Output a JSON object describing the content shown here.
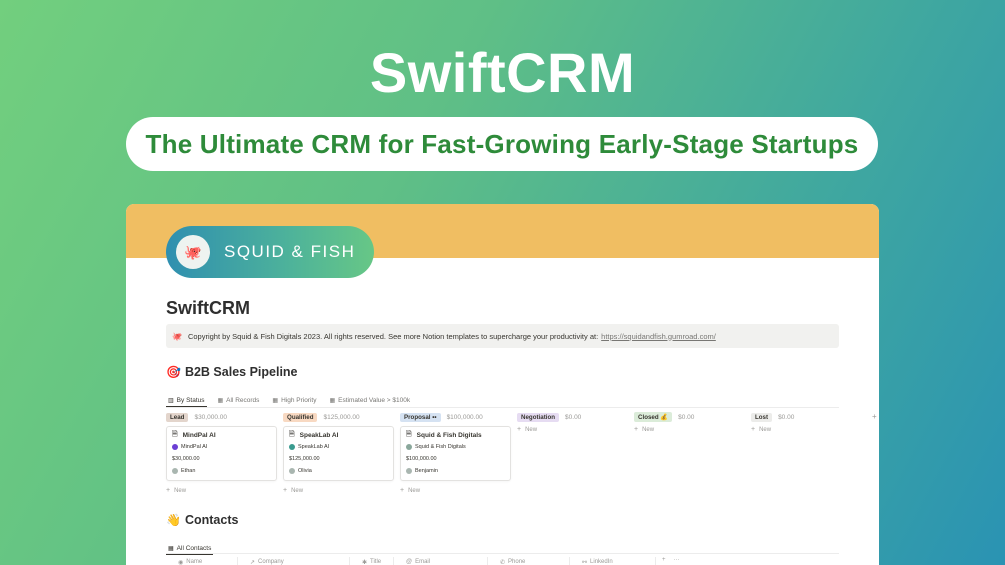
{
  "hero": {
    "title": "SwiftCRM",
    "tagline": "The Ultimate CRM for Fast-Growing Early-Stage Startups"
  },
  "brand": {
    "name": "SQUID & FISH",
    "logo_icon": "squid-fish-logo"
  },
  "page": {
    "title": "SwiftCRM",
    "callout": {
      "icon": "squid-icon",
      "text": "Copyright by Squid & Fish Digitals 2023. All rights reserved. See more Notion templates to supercharge your productivity at:",
      "link": "https://squidandfish.gumroad.com/"
    }
  },
  "pipeline": {
    "heading": "B2B Sales Pipeline",
    "heading_icon": "target-icon",
    "views": [
      {
        "label": "By Status",
        "icon": "board-icon"
      },
      {
        "label": "All Records",
        "icon": "table-icon"
      },
      {
        "label": "High Priority",
        "icon": "table-icon"
      },
      {
        "label": "Estimated Value > $100k",
        "icon": "table-icon"
      }
    ],
    "columns": [
      {
        "status": "Lead",
        "total": "$30,000.00",
        "color": "#e3d5cc",
        "cards": [
          {
            "title": "MindPal AI",
            "company": "MindPal AI",
            "value": "$30,000.00",
            "owner": "Ethan",
            "company_color": "#6b3fd4"
          }
        ]
      },
      {
        "status": "Qualified",
        "total": "$125,000.00",
        "color": "#f8d9c2",
        "cards": [
          {
            "title": "SpeakLab AI",
            "company": "SpeakLab AI",
            "value": "$125,000.00",
            "owner": "Olivia",
            "company_color": "#3a9b8f"
          }
        ]
      },
      {
        "status": "Proposal",
        "status_suffix": "••",
        "total": "$100,000.00",
        "color": "#d5e2f2",
        "cards": [
          {
            "title": "Squid & Fish Digitals",
            "company": "Squid & Fish Digitals",
            "value": "$100,000.00",
            "owner": "Benjamin",
            "company_color": "#8aa79b"
          }
        ]
      },
      {
        "status": "Negotiation",
        "total": "$0.00",
        "color": "#e6dcf2",
        "cards": []
      },
      {
        "status": "Closed",
        "status_suffix": "💰",
        "total": "$0.00",
        "color": "#dbecd9",
        "cards": []
      },
      {
        "status": "Lost",
        "total": "$0.00",
        "color": "#ececea",
        "cards": []
      }
    ],
    "new_label": "New",
    "add_column": "+"
  },
  "contacts": {
    "heading": "Contacts",
    "heading_icon": "wave-icon",
    "view": "All Contacts",
    "columns": [
      {
        "label": "Name",
        "icon": "person-icon"
      },
      {
        "label": "Company",
        "icon": "arrow-icon"
      },
      {
        "label": "Title",
        "icon": "star-icon"
      },
      {
        "label": "Email",
        "icon": "at-icon"
      },
      {
        "label": "Phone",
        "icon": "phone-icon"
      },
      {
        "label": "LinkedIn",
        "icon": "link-person-icon"
      }
    ],
    "add": "+",
    "more": "···"
  }
}
